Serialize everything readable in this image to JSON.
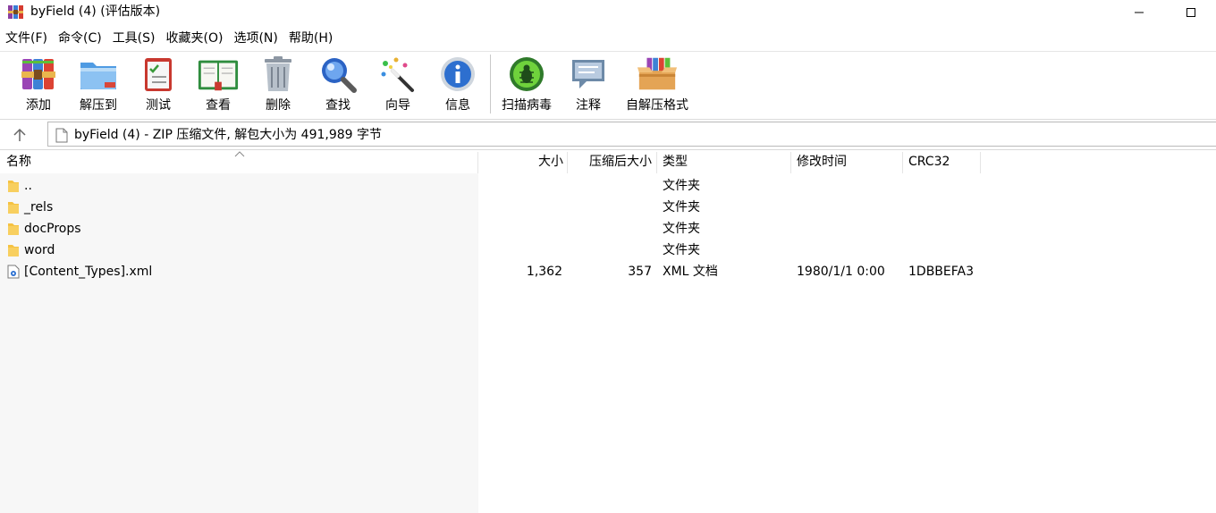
{
  "window": {
    "title": "byField (4) (评估版本)"
  },
  "menu": [
    "文件(F)",
    "命令(C)",
    "工具(S)",
    "收藏夹(O)",
    "选项(N)",
    "帮助(H)"
  ],
  "toolbar": {
    "add": "添加",
    "extract_to": "解压到",
    "test": "测试",
    "view": "查看",
    "delete": "删除",
    "find": "查找",
    "wizard": "向导",
    "info": "信息",
    "virus_scan": "扫描病毒",
    "comment": "注释",
    "sfx": "自解压格式"
  },
  "address": {
    "text": "byField (4) - ZIP 压缩文件, 解包大小为 491,989 字节"
  },
  "columns": {
    "name": "名称",
    "size": "大小",
    "packed": "压缩后大小",
    "type": "类型",
    "modified": "修改时间",
    "crc": "CRC32"
  },
  "rows": [
    {
      "name": "..",
      "size": "",
      "packed": "",
      "type": "文件夹",
      "modified": "",
      "crc": "",
      "icon": "folder-icon"
    },
    {
      "name": "_rels",
      "size": "",
      "packed": "",
      "type": "文件夹",
      "modified": "",
      "crc": "",
      "icon": "folder-icon"
    },
    {
      "name": "docProps",
      "size": "",
      "packed": "",
      "type": "文件夹",
      "modified": "",
      "crc": "",
      "icon": "folder-icon"
    },
    {
      "name": "word",
      "size": "",
      "packed": "",
      "type": "文件夹",
      "modified": "",
      "crc": "",
      "icon": "folder-icon"
    },
    {
      "name": "[Content_Types].xml",
      "size": "1,362",
      "packed": "357",
      "type": "XML 文档",
      "modified": "1980/1/1 0:00",
      "crc": "1DBBEFA3",
      "icon": "xml-file-icon"
    }
  ],
  "colors": {
    "folder": "#f5c242",
    "name_column_bg": "#f7f7f7",
    "accent": "#2a6fd1"
  }
}
